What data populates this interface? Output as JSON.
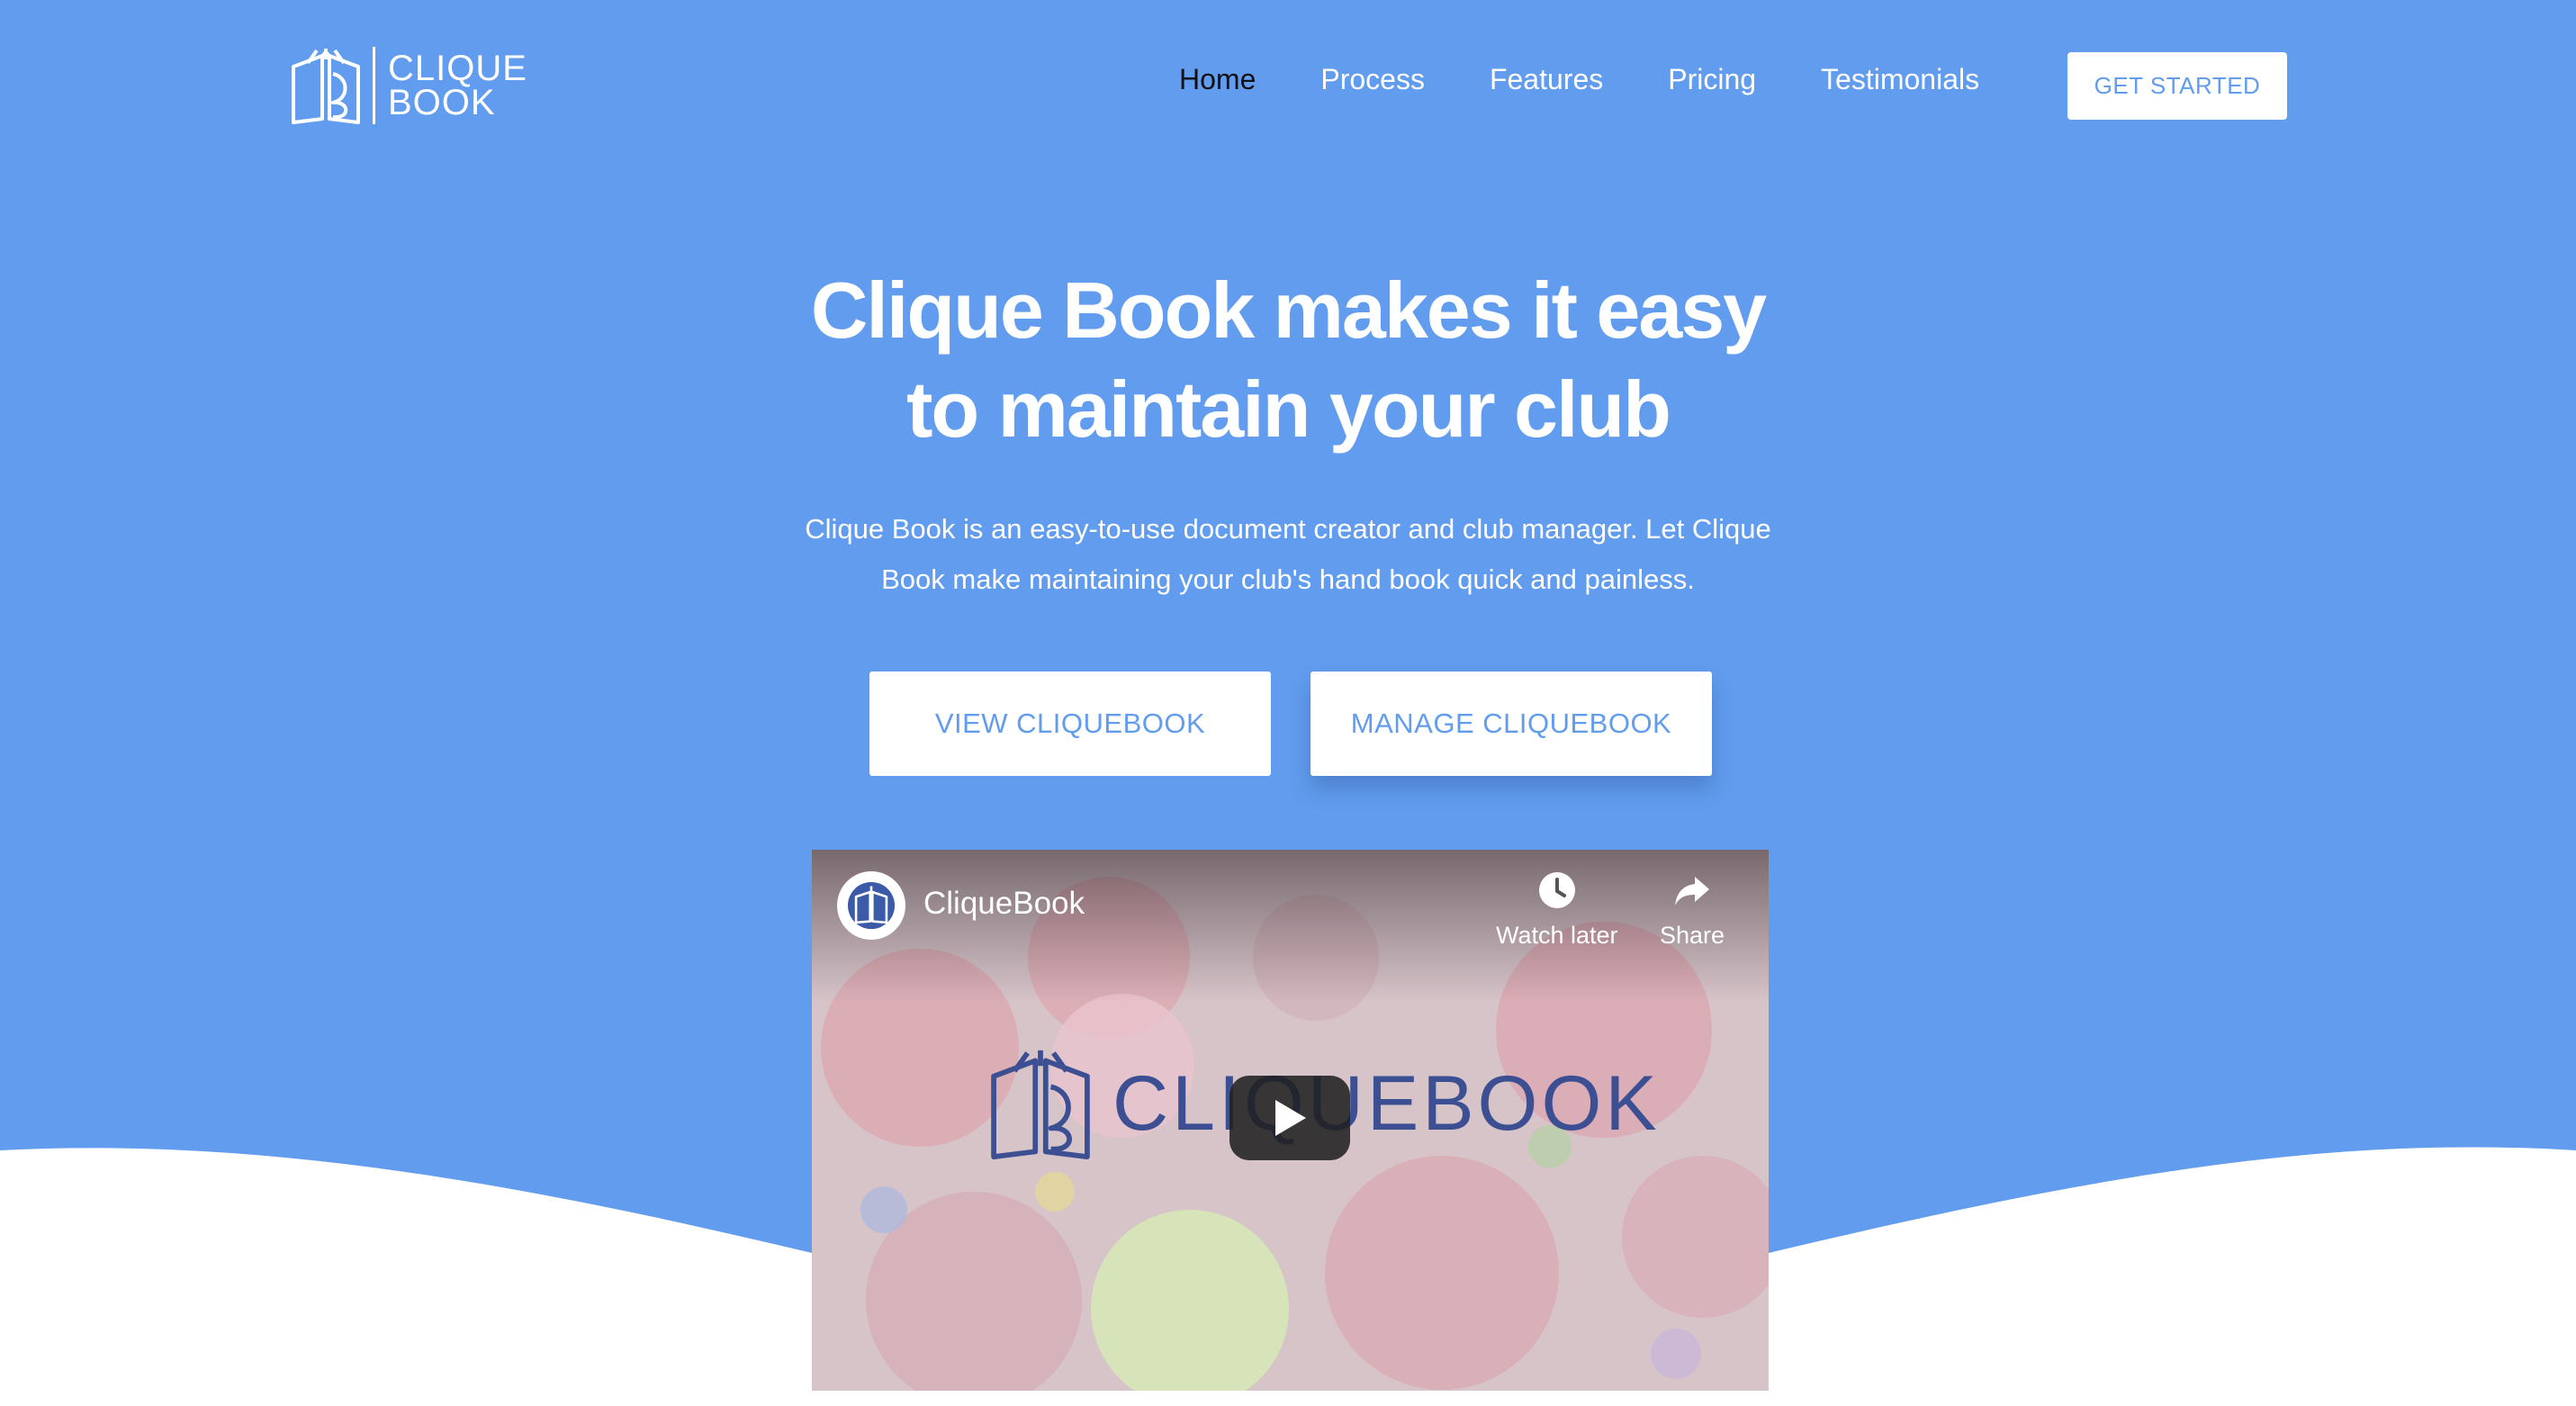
{
  "colors": {
    "hero_background": "#619cee",
    "accent": "#619cee",
    "white": "#ffffff",
    "logo_blue": "#3b4f92"
  },
  "header": {
    "logo": {
      "line1": "CLIQUE",
      "line2": "BOOK",
      "icon": "open-book-icon"
    },
    "nav": {
      "items": [
        {
          "label": "Home",
          "active": true
        },
        {
          "label": "Process",
          "active": false
        },
        {
          "label": "Features",
          "active": false
        },
        {
          "label": "Pricing",
          "active": false
        },
        {
          "label": "Testimonials",
          "active": false
        }
      ]
    },
    "cta_label": "GET STARTED"
  },
  "hero": {
    "title_line1": "Clique Book makes it easy",
    "title_line2": "to maintain your club",
    "subtitle_line1": "Clique Book is an easy-to-use document creator and club manager. Let Clique",
    "subtitle_line2": "Book make maintaining your club's hand book quick and painless.",
    "buttons": {
      "view": "VIEW CLIQUEBOOK",
      "manage": "MANAGE CLIQUEBOOK"
    }
  },
  "video": {
    "channel_title": "CliqueBook",
    "watch_later_label": "Watch later",
    "share_label": "Share",
    "thumbnail_logo_text": "CLIQUEBOOK",
    "icons": [
      "channel-avatar-icon",
      "clock-icon",
      "share-arrow-icon",
      "play-icon"
    ]
  }
}
